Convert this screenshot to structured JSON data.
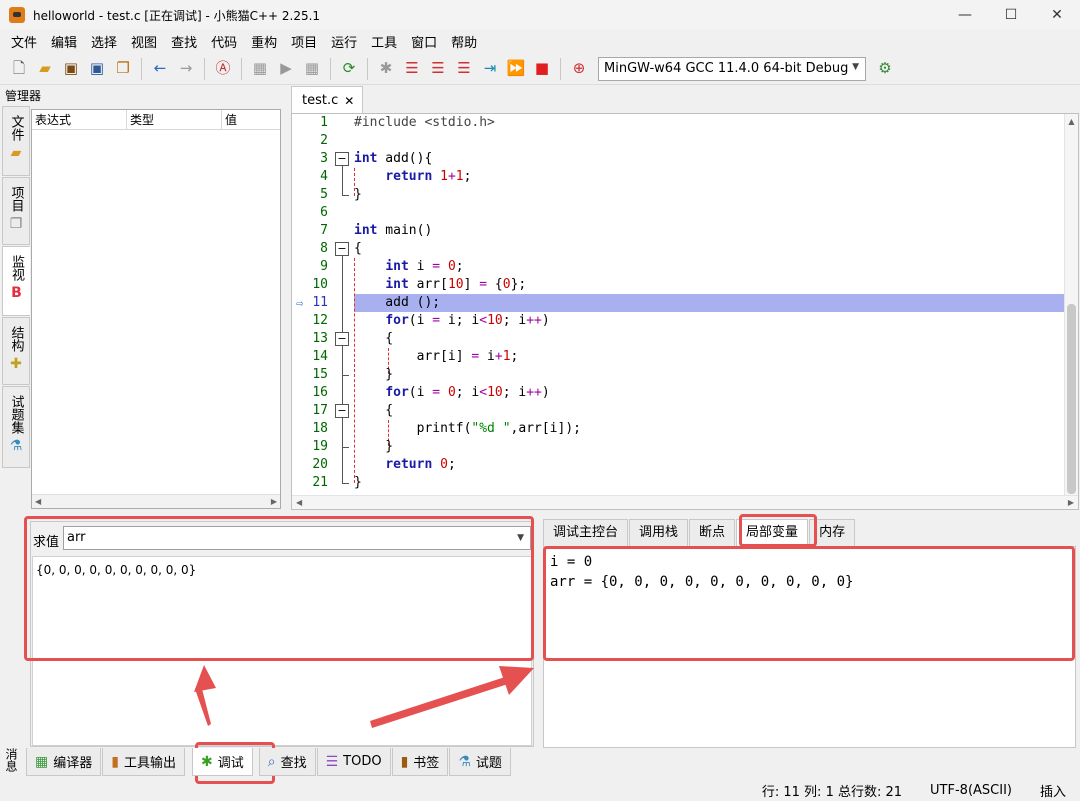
{
  "window": {
    "title": "helloworld - test.c [正在调试] - 小熊猫C++ 2.25.1"
  },
  "menu": [
    "文件",
    "编辑",
    "选择",
    "视图",
    "查找",
    "代码",
    "重构",
    "项目",
    "运行",
    "工具",
    "窗口",
    "帮助"
  ],
  "toolbar": {
    "compiler": "MinGW-w64 GCC 11.4.0 64-bit Debug"
  },
  "manager": {
    "label": "管理器",
    "side_tabs": [
      {
        "label": "文件",
        "icon": "folder-icon"
      },
      {
        "label": "项目",
        "icon": "project-icon"
      },
      {
        "label": "监视",
        "icon": "watch-icon"
      },
      {
        "label": "结构",
        "icon": "structure-icon"
      },
      {
        "label": "试题集",
        "icon": "problem-set-icon"
      }
    ],
    "watch_columns": [
      "表达式",
      "类型",
      "值"
    ]
  },
  "editor": {
    "tab_label": "test.c",
    "close_glyph": "✕",
    "current_line": 11,
    "line_numbers": [
      "1",
      "2",
      "3",
      "4",
      "5",
      "6",
      "7",
      "8",
      "9",
      "10",
      "11",
      "12",
      "13",
      "14",
      "15",
      "16",
      "17",
      "18",
      "19",
      "20",
      "21"
    ],
    "exec_marker": "⇨"
  },
  "evaluate": {
    "label": "求值",
    "input": "arr",
    "output": "{0, 0, 0, 0, 0, 0, 0, 0, 0, 0}"
  },
  "debug_tabs": [
    "调试主控台",
    "调用栈",
    "断点",
    "局部变量",
    "内存"
  ],
  "locals": {
    "line1": "i = 0",
    "line2": "arr = {0, 0, 0, 0, 0, 0, 0, 0, 0, 0}"
  },
  "message_label": "消息",
  "bottom_tabs": [
    {
      "label": "编译器",
      "icon": "compiler-icon"
    },
    {
      "label": "工具输出",
      "icon": "tool-output-icon"
    },
    {
      "label": "调试",
      "icon": "debug-bug-icon"
    },
    {
      "label": "查找",
      "icon": "search-icon"
    },
    {
      "label": "TODO",
      "icon": "todo-icon"
    },
    {
      "label": "书签",
      "icon": "bookmark-icon"
    },
    {
      "label": "试题",
      "icon": "problem-icon"
    }
  ],
  "status": {
    "position": "行: 11 列: 1 总行数: 21",
    "encoding": "UTF-8(ASCII)",
    "mode": "插入"
  },
  "colors": {
    "highlight": "#a8b0f0",
    "annotation": "#e55050"
  }
}
